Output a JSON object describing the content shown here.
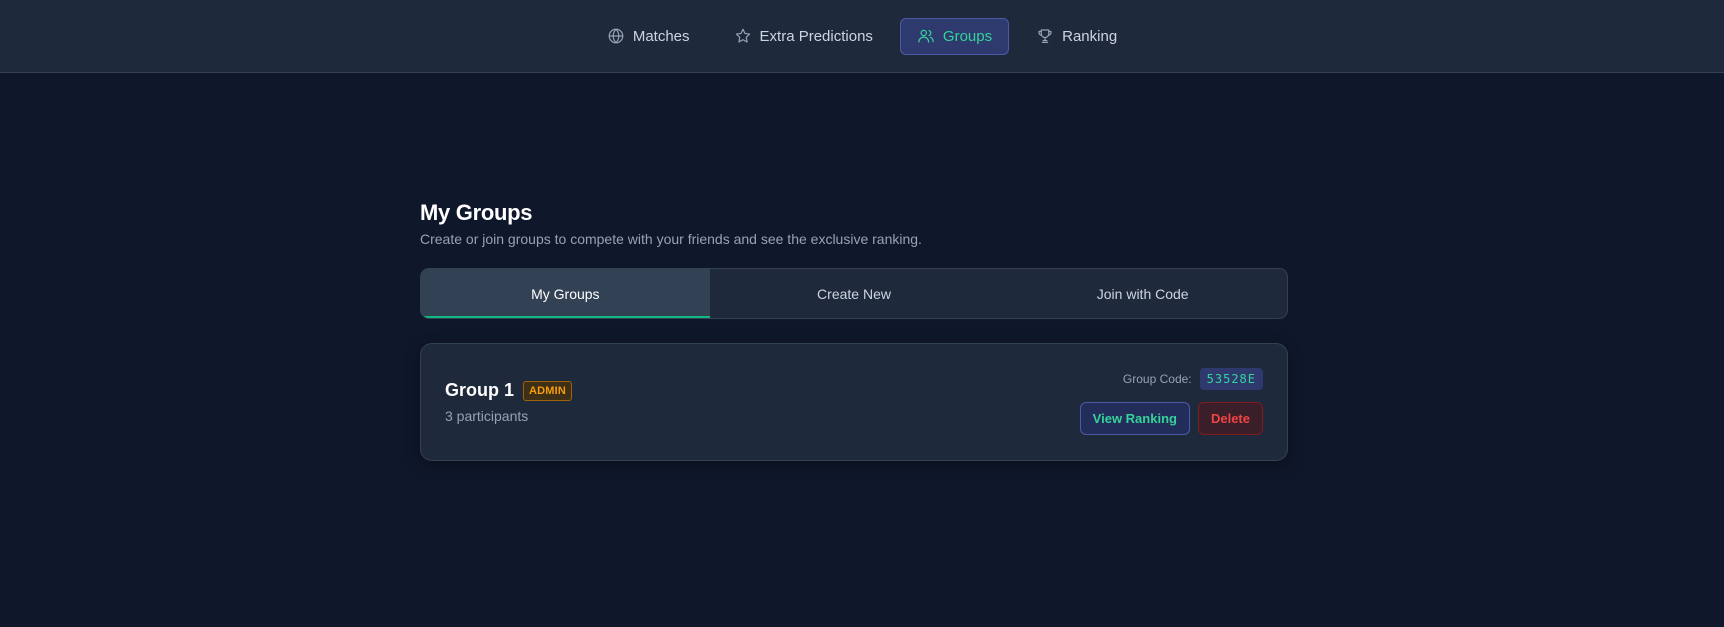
{
  "nav": {
    "items": [
      {
        "label": "Matches",
        "icon": "globe-icon"
      },
      {
        "label": "Extra Predictions",
        "icon": "star-icon"
      },
      {
        "label": "Groups",
        "icon": "users-icon",
        "active": true
      },
      {
        "label": "Ranking",
        "icon": "trophy-icon"
      }
    ]
  },
  "page": {
    "title": "My Groups",
    "subtitle": "Create or join groups to compete with your friends and see the exclusive ranking."
  },
  "tabs": [
    {
      "label": "My Groups",
      "active": true
    },
    {
      "label": "Create New"
    },
    {
      "label": "Join with Code"
    }
  ],
  "groups": [
    {
      "name": "Group 1",
      "badge": "ADMIN",
      "participants": "3 participants",
      "code_label": "Group Code:",
      "code": "53528E",
      "view_label": "View Ranking",
      "delete_label": "Delete"
    }
  ],
  "colors": {
    "accent": "#34d399",
    "danger": "#ef4444",
    "badge": "#f59e0b",
    "background": "#0f172a"
  }
}
